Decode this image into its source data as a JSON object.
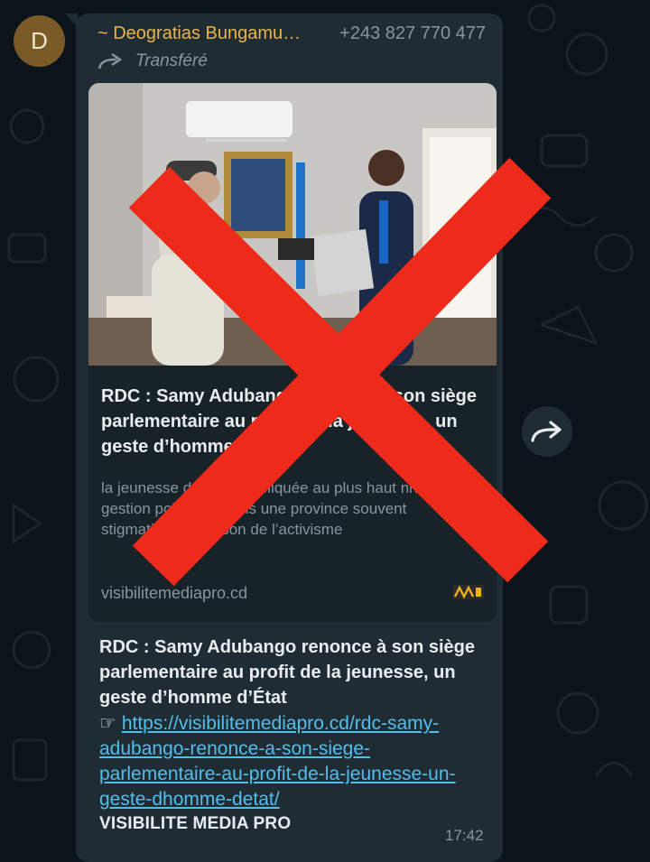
{
  "sender": {
    "avatar_letter": "D",
    "name": "~ Deogratias Bungamu…",
    "phone": "+243 827 770 477"
  },
  "forwarded_label": "Transféré",
  "link_preview": {
    "title": "RDC : Samy Adubango renonce à son siège parlementaire au profit de la jeunesse, un geste d’homme d’État",
    "description": "la jeunesse doit être impliquée au plus haut niveau de la gestion politique. Dans une province souvent stigmatisée en raison de l’activisme",
    "domain": "visibilitemediapro.cd"
  },
  "message": {
    "title": "RDC : Samy Adubango renonce à son siège parlementaire au profit de la jeunesse, un geste d’homme d’État",
    "link_icon": "☞",
    "link": "https://visibilitemediapro.cd/rdc-samy-adubango-renonce-a-son-siege-parlementaire-au-profit-de-la-jeunesse-un-geste-dhomme-detat/",
    "source": "VISIBILITE MEDIA PRO",
    "time": "17:42"
  },
  "icons": {
    "forward": "forwarded-arrow-icon",
    "share": "share-forward-icon",
    "overlay": "red-x-mark"
  },
  "colors": {
    "background": "#0b141a",
    "bubble": "#1f2c34",
    "sender_name": "#e9b54b",
    "link": "#53bdeb",
    "red_x": "#ee2a1b"
  }
}
